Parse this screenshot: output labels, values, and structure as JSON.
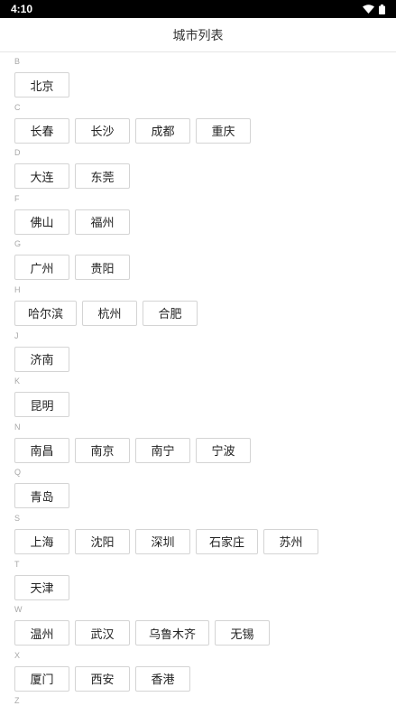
{
  "status_bar": {
    "time": "4:10",
    "icons": [
      "wifi-icon",
      "battery-icon"
    ]
  },
  "header": {
    "title": "城市列表"
  },
  "sections": [
    {
      "letter": "B",
      "cities": [
        "北京"
      ]
    },
    {
      "letter": "C",
      "cities": [
        "长春",
        "长沙",
        "成都",
        "重庆"
      ]
    },
    {
      "letter": "D",
      "cities": [
        "大连",
        "东莞"
      ]
    },
    {
      "letter": "F",
      "cities": [
        "佛山",
        "福州"
      ]
    },
    {
      "letter": "G",
      "cities": [
        "广州",
        "贵阳"
      ]
    },
    {
      "letter": "H",
      "cities": [
        "哈尔滨",
        "杭州",
        "合肥"
      ]
    },
    {
      "letter": "J",
      "cities": [
        "济南"
      ]
    },
    {
      "letter": "K",
      "cities": [
        "昆明"
      ]
    },
    {
      "letter": "N",
      "cities": [
        "南昌",
        "南京",
        "南宁",
        "宁波"
      ]
    },
    {
      "letter": "Q",
      "cities": [
        "青岛"
      ]
    },
    {
      "letter": "S",
      "cities": [
        "上海",
        "沈阳",
        "深圳",
        "石家庄",
        "苏州"
      ]
    },
    {
      "letter": "T",
      "cities": [
        "天津"
      ]
    },
    {
      "letter": "W",
      "cities": [
        "温州",
        "武汉",
        "乌鲁木齐",
        "无锡"
      ]
    },
    {
      "letter": "X",
      "cities": [
        "厦门",
        "西安",
        "香港"
      ]
    },
    {
      "letter": "Z",
      "cities": []
    }
  ]
}
